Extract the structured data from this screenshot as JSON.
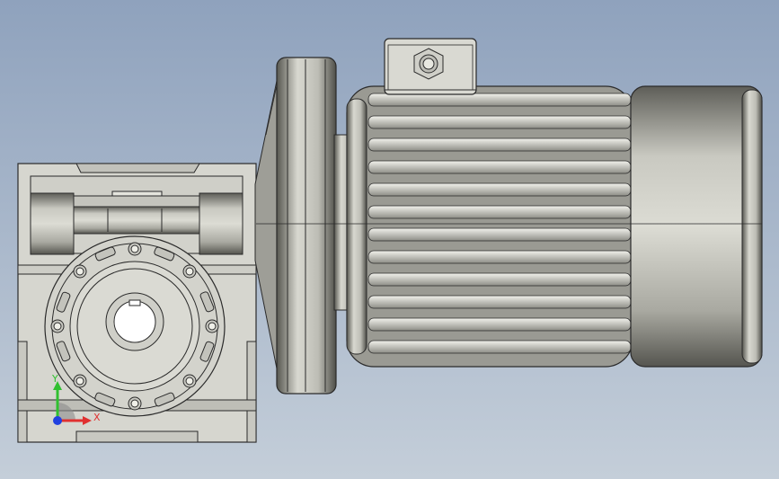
{
  "viewport": {
    "background_top": "#8fa2bd",
    "background_bottom": "#c4ced9",
    "model": "worm-gear-reducer-with-motor",
    "view": "front"
  },
  "triad": {
    "x_label": "X",
    "y_label": "Y",
    "x_color": "#e03030",
    "y_color": "#30c030",
    "z_color": "#2040e0"
  }
}
